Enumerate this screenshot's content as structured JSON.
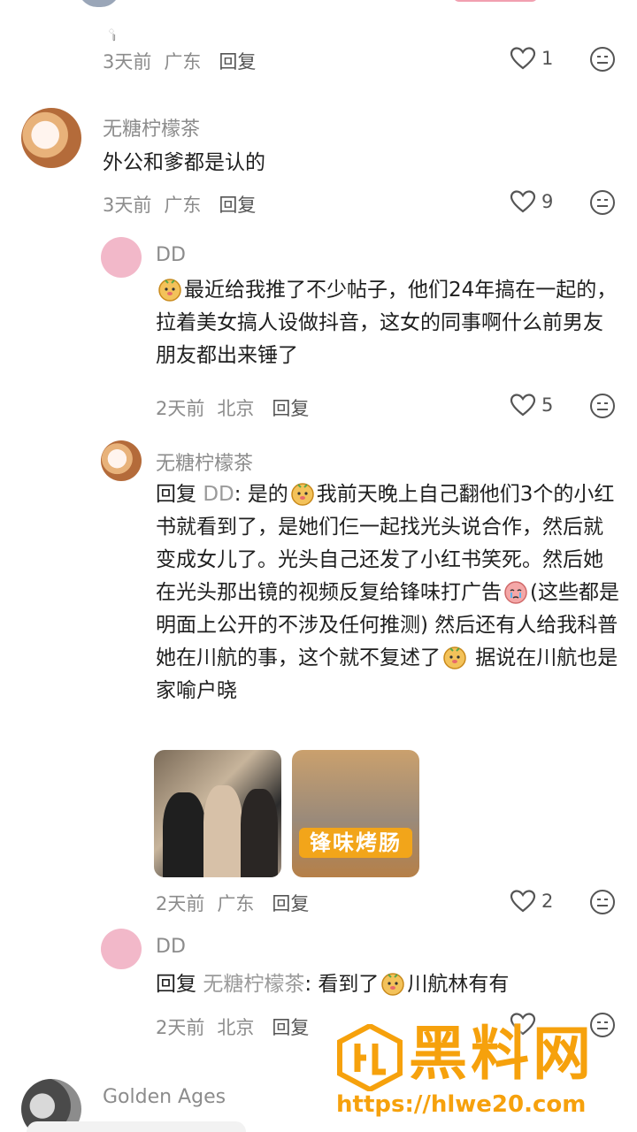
{
  "top_comment_meta": {
    "time": "3天前",
    "location": "广东",
    "reply": "回复",
    "likes": "1"
  },
  "comments": [
    {
      "name": "无糖柠檬茶",
      "text": "外公和爹都是认的",
      "time": "3天前",
      "location": "广东",
      "reply": "回复",
      "likes": "9"
    },
    {
      "name": "DD",
      "text": "最近给我推了不少帖子，他们24年搞在一起的，拉着美女搞人设做抖音，这女的同事啊什么前男友朋友都出来锤了",
      "time": "2天前",
      "location": "北京",
      "reply": "回复",
      "likes": "5"
    },
    {
      "name": "无糖柠檬茶",
      "reply_prefix": "回复",
      "reply_target": "DD",
      "text_a": ": 是的",
      "text_b": "我前天晚上自己翻他们3个的小红书就看到了，是她们仨一起找光头说合作，然后就变成女儿了。光头自己还发了小红书笑死。然后她在光头那出镜的视频反复给锋味打广告",
      "text_c": "(这些都是明面上公开的不涉及任何推测) 然后还有人给我科普她在川航的事，这个就不复述了",
      "text_d": " 据说在川航也是家喻户晓",
      "image_banner": "锋味烤肠",
      "time": "2天前",
      "location": "广东",
      "reply": "回复",
      "likes": "2"
    },
    {
      "name": "DD",
      "reply_prefix": "回复",
      "reply_target": "无糖柠檬茶",
      "text_a": ": 看到了",
      "text_b": "川航林有有",
      "time": "2天前",
      "location": "北京",
      "reply": "回复"
    },
    {
      "name": "Golden Ages"
    }
  ],
  "watermark": {
    "title": "黑料网",
    "url": "https://hlwe20.com"
  },
  "colors": {
    "accent": "#f6a10c",
    "muted": "#8c8c8c",
    "avatar_pink": "#f2b8c9"
  }
}
